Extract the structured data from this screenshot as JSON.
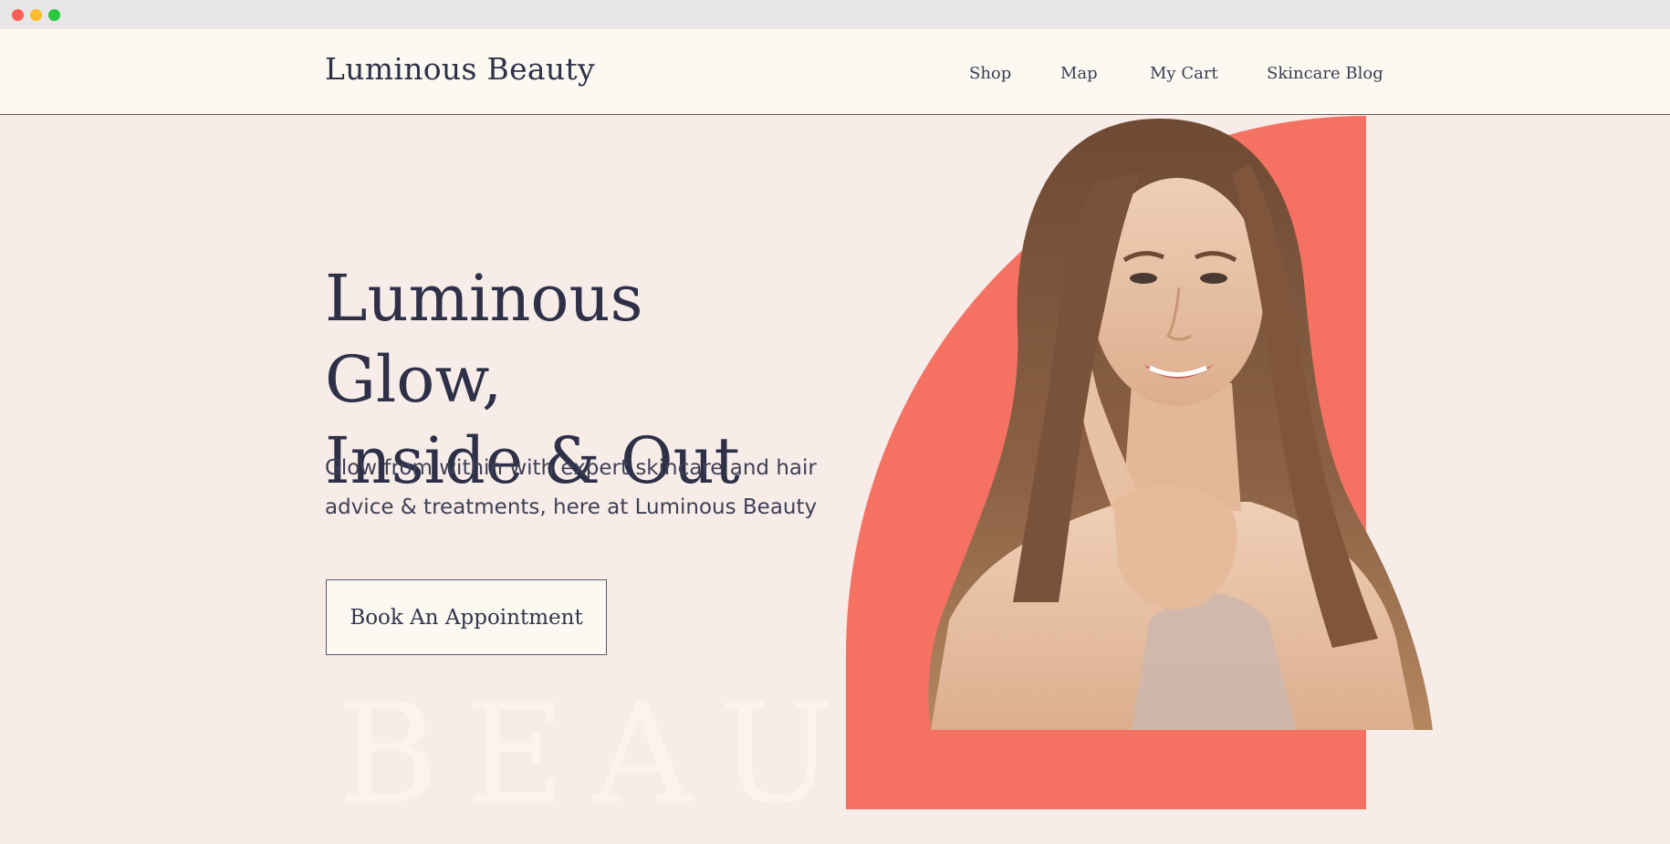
{
  "header": {
    "brand": "Luminous Beauty",
    "nav": [
      "Shop",
      "Map",
      "My Cart",
      "Skincare Blog"
    ]
  },
  "hero": {
    "headline_line1": "Luminous Glow,",
    "headline_line2": "Inside & Out",
    "subtext_line1": "Glow from within with expert skincare and hair",
    "subtext_line2": "advice & treatments, here at Luminous Beauty",
    "cta": "Book An Appointment",
    "watermark": "BEAUTY"
  },
  "colors": {
    "background": "#f7ece8",
    "header_bg": "#fcf9f2",
    "accent": "#f57263",
    "text": "#2d3047"
  },
  "icons": [
    "close-window-icon",
    "minimize-window-icon",
    "maximize-window-icon"
  ]
}
